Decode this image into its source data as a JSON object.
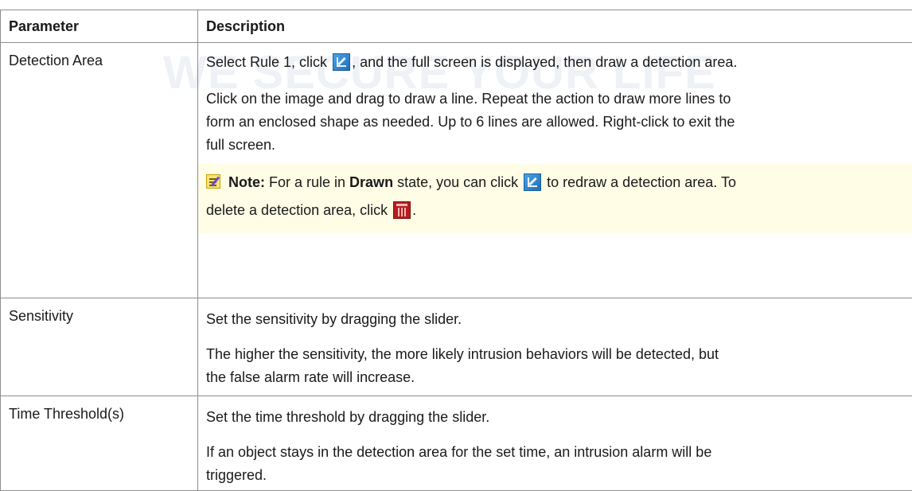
{
  "watermark": {
    "text": "WE SECURE YOUR LIFE"
  },
  "table": {
    "headers": {
      "parameter": "Parameter",
      "description": "Description"
    },
    "rows": [
      {
        "parameter": "Detection Area",
        "desc_1": {
          "before_icon": "Select Rule 1, click ",
          "icon": "edit-draw-icon",
          "after_icon": ", and the full screen is displayed, then draw a detection area."
        },
        "desc_2_line_1": "Click on the image and drag to draw a line. Repeat the action to draw more lines to",
        "desc_2_line_2": "form an enclosed shape as needed. Up to 6 lines are allowed. Right-click to exit the",
        "desc_2_line_3": "full screen.",
        "note": {
          "icon": "note-icon",
          "label": "Note:",
          "text_1": " For a rule in ",
          "bold": "Drawn",
          "text_2": " state, you can click ",
          "edit_icon": "edit-draw-icon",
          "text_3": " to redraw a detection area. To",
          "text_4": "delete a detection area, click ",
          "trash_icon": "trash-icon",
          "text_5": "."
        }
      },
      {
        "parameter": "Sensitivity",
        "desc_1": "Set the sensitivity by dragging the slider.",
        "desc_2_line_1": "The higher the sensitivity, the more likely intrusion behaviors will be detected, but",
        "desc_2_line_2": "the false alarm rate will increase."
      },
      {
        "parameter": "Time Threshold(s)",
        "desc_1": "Set the time threshold by dragging the slider.",
        "desc_2_line_1": "If an object stays in the detection area for the set time, an intrusion alarm will be",
        "desc_2_line_2": "triggered."
      }
    ]
  },
  "colors": {
    "note_bg": "#fffde6",
    "border": "#8e8e8e",
    "edit_icon": "#2b83d3",
    "trash_icon": "#b51d1d"
  }
}
